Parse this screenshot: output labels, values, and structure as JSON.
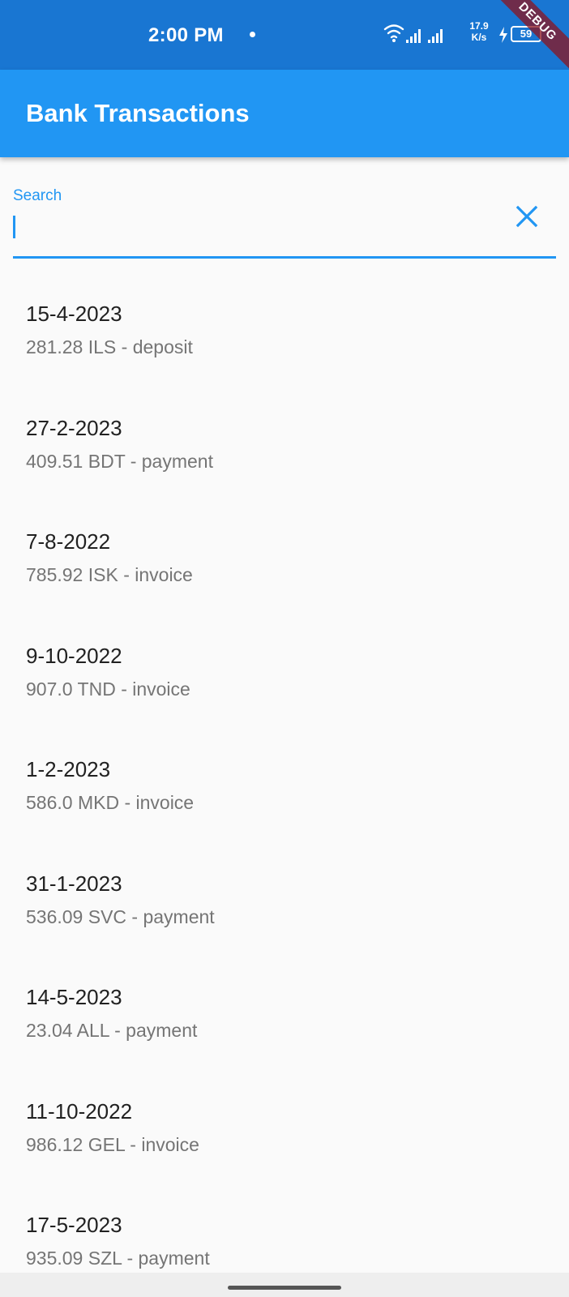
{
  "status_bar": {
    "time": "2:00 PM",
    "net_speed_value": "17.9",
    "net_speed_unit": "K/s",
    "battery": "59",
    "debug_banner": "DEBUG"
  },
  "app_bar": {
    "title": "Bank Transactions"
  },
  "search": {
    "label": "Search",
    "value": "",
    "clear_icon": "close-icon"
  },
  "transactions": [
    {
      "date": "15-4-2023",
      "detail": "281.28 ILS - deposit"
    },
    {
      "date": "27-2-2023",
      "detail": "409.51 BDT - payment"
    },
    {
      "date": "7-8-2022",
      "detail": "785.92 ISK - invoice"
    },
    {
      "date": "9-10-2022",
      "detail": "907.0 TND - invoice"
    },
    {
      "date": "1-2-2023",
      "detail": "586.0 MKD - invoice"
    },
    {
      "date": "31-1-2023",
      "detail": "536.09 SVC - payment"
    },
    {
      "date": "14-5-2023",
      "detail": "23.04 ALL - payment"
    },
    {
      "date": "11-10-2022",
      "detail": "986.12 GEL - invoice"
    },
    {
      "date": "17-5-2023",
      "detail": "935.09 SZL - payment"
    }
  ],
  "colors": {
    "status_bar": "#1976d2",
    "app_bar": "#2196f3",
    "accent": "#2196f3",
    "background": "#fafafa"
  }
}
